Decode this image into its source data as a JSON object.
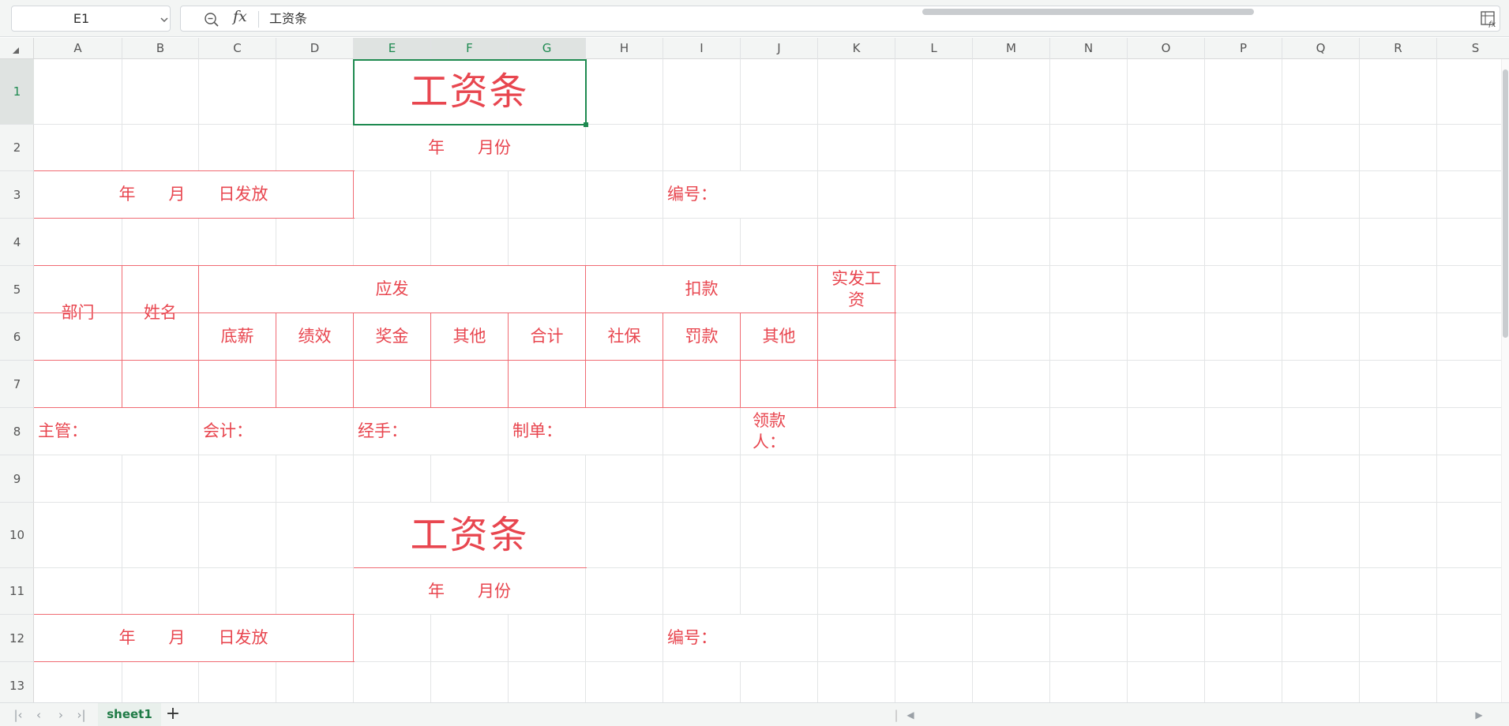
{
  "name_box": {
    "value": "E1"
  },
  "formula_bar": {
    "content": "工资条"
  },
  "columns": [
    "A",
    "B",
    "C",
    "D",
    "E",
    "F",
    "G",
    "H",
    "I",
    "J",
    "K",
    "L",
    "M",
    "N",
    "O",
    "P",
    "Q",
    "R",
    "S"
  ],
  "rows": [
    "1",
    "2",
    "3",
    "4",
    "5",
    "6",
    "7",
    "8",
    "9",
    "10",
    "11",
    "12",
    "13"
  ],
  "selected": {
    "cell": "E1",
    "columns": [
      "E",
      "F",
      "G"
    ],
    "row": "1"
  },
  "sheet": {
    "title": "工资条",
    "month_line": "年　　月份",
    "issue_date": "年　　月　　日发放",
    "number_label": "编号：",
    "headers": {
      "dept": "部门",
      "name": "姓名",
      "payable": "应发",
      "deduction": "扣款",
      "net_pay": "实发工资",
      "sub": [
        "底薪",
        "绩效",
        "奖金",
        "其他",
        "合计",
        "社保",
        "罚款",
        "其他"
      ]
    },
    "signatures": {
      "supervisor": "主管：",
      "accountant": "会计：",
      "handler": "经手：",
      "preparer": "制单：",
      "recipient": "领款人："
    },
    "title2": "工资条",
    "month_line2": "年　　月份",
    "issue_date2": "年　　月　　日发放",
    "number_label2": "编号："
  },
  "sheet_tabs": [
    {
      "label": "sheet1",
      "active": true
    }
  ],
  "colors": {
    "accent": "#1e8a50",
    "form_red": "#e8464f"
  }
}
